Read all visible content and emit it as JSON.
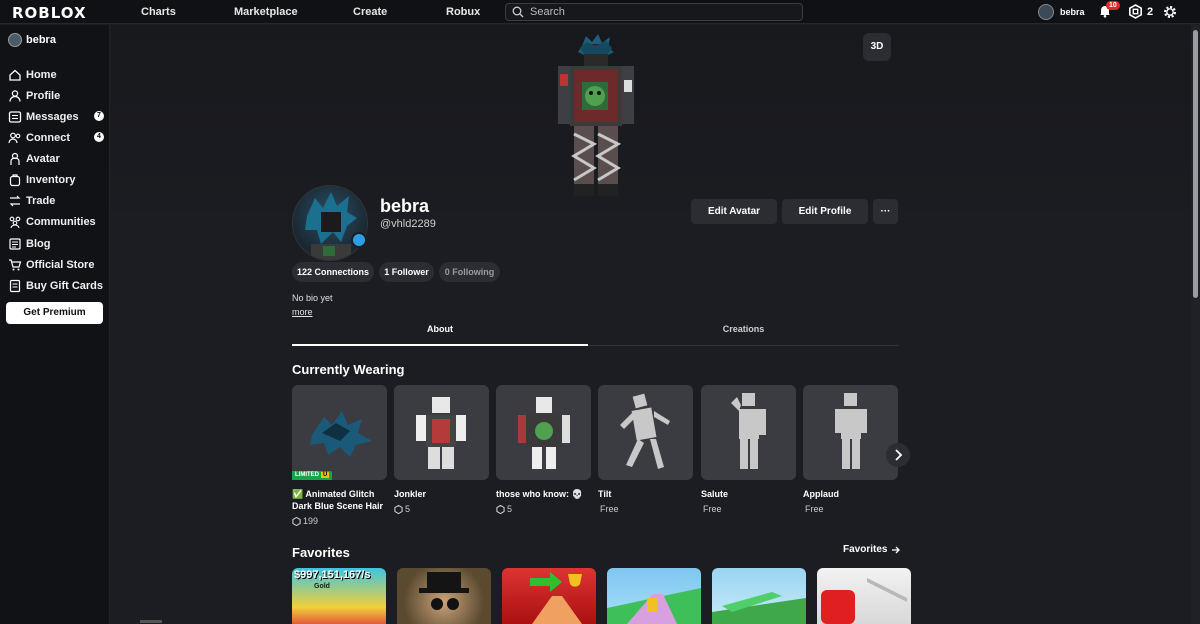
{
  "app": {
    "logo": "ROBLOX"
  },
  "topnav": {
    "links": [
      "Charts",
      "Marketplace",
      "Create",
      "Robux"
    ],
    "search_placeholder": "Search",
    "user_name": "bebra",
    "notifications_count": "10",
    "robux_balance": "2"
  },
  "sidebar": {
    "user_name": "bebra",
    "items": [
      {
        "label": "Home",
        "icon": "home-icon"
      },
      {
        "label": "Profile",
        "icon": "profile-icon"
      },
      {
        "label": "Messages",
        "icon": "messages-icon",
        "badge": "7"
      },
      {
        "label": "Connect",
        "icon": "connect-icon",
        "badge": "4"
      },
      {
        "label": "Avatar",
        "icon": "avatar-icon"
      },
      {
        "label": "Inventory",
        "icon": "inventory-icon"
      },
      {
        "label": "Trade",
        "icon": "trade-icon"
      },
      {
        "label": "Communities",
        "icon": "communities-icon"
      },
      {
        "label": "Blog",
        "icon": "blog-icon"
      },
      {
        "label": "Official Store",
        "icon": "cart-icon"
      },
      {
        "label": "Buy Gift Cards",
        "icon": "gift-card-icon"
      }
    ],
    "premium_label": "Get Premium"
  },
  "hero": {
    "view_3d_label": "3D"
  },
  "profile": {
    "display_name": "bebra",
    "handle": "@vhld2289",
    "edit_avatar_label": "Edit Avatar",
    "edit_profile_label": "Edit Profile",
    "more_label": "···",
    "stats": {
      "connections": "122 Connections",
      "followers": "1 Follower",
      "following": "0 Following"
    },
    "bio": "No bio yet",
    "bio_more": "more"
  },
  "tabs": {
    "about": "About",
    "creations": "Creations"
  },
  "currently_wearing": {
    "title": "Currently Wearing",
    "limited_label": "LIMITED",
    "limited_u": "U",
    "items": [
      {
        "name": "✅ Animated Glitch Dark Blue Scene Hair",
        "price": "199",
        "robux": true
      },
      {
        "name": "Jonkler",
        "price": "5",
        "robux": true
      },
      {
        "name": "those who know: 💀",
        "price": "5",
        "robux": true
      },
      {
        "name": "Tilt",
        "price": "Free",
        "robux": false
      },
      {
        "name": "Salute",
        "price": "Free",
        "robux": false
      },
      {
        "name": "Applaud",
        "price": "Free",
        "robux": false
      }
    ]
  },
  "favorites": {
    "title": "Favorites",
    "link_label": "Favorites",
    "first_thumb_text": "$997,151,167/s",
    "first_thumb_subtext": "Gold"
  }
}
